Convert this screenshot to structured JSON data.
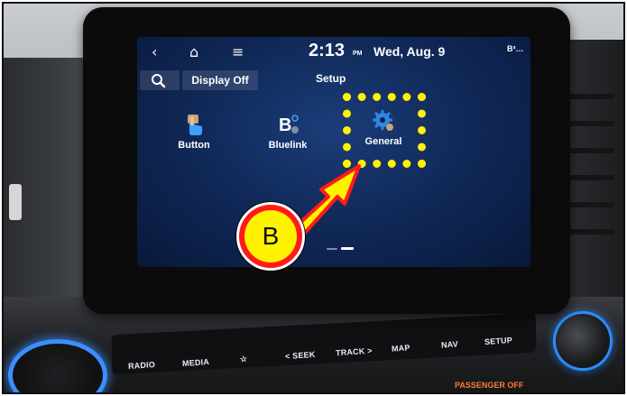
{
  "status_bar": {
    "back_icon": "chevron-left-icon",
    "home_icon": "home-icon",
    "menu_icon": "hamburger-menu-icon",
    "time": "2:13",
    "ampm": "PM",
    "date": "Wed, Aug. 9",
    "signal": "B³…"
  },
  "sub_bar": {
    "search_icon": "search-icon",
    "display_off_label": "Display Off",
    "page_title": "Setup"
  },
  "menu": [
    {
      "label": "Button",
      "icon": "button-hand-icon"
    },
    {
      "label": "Bluelink",
      "icon": "bluelink-icon"
    },
    {
      "label": "General",
      "icon": "gear-icon"
    }
  ],
  "annotation": {
    "callout_letter": "B",
    "highlight_color": "#fff200",
    "callout_color": "#ff1a1a"
  },
  "hardware_buttons": [
    "RADIO",
    "MEDIA",
    "☆",
    "< SEEK",
    "TRACK >",
    "MAP",
    "NAV",
    "SETUP"
  ],
  "console_label": "PASSENGER OFF",
  "colors": {
    "screen_bg": "#112a5a",
    "accent_blue": "#2b8cff"
  }
}
